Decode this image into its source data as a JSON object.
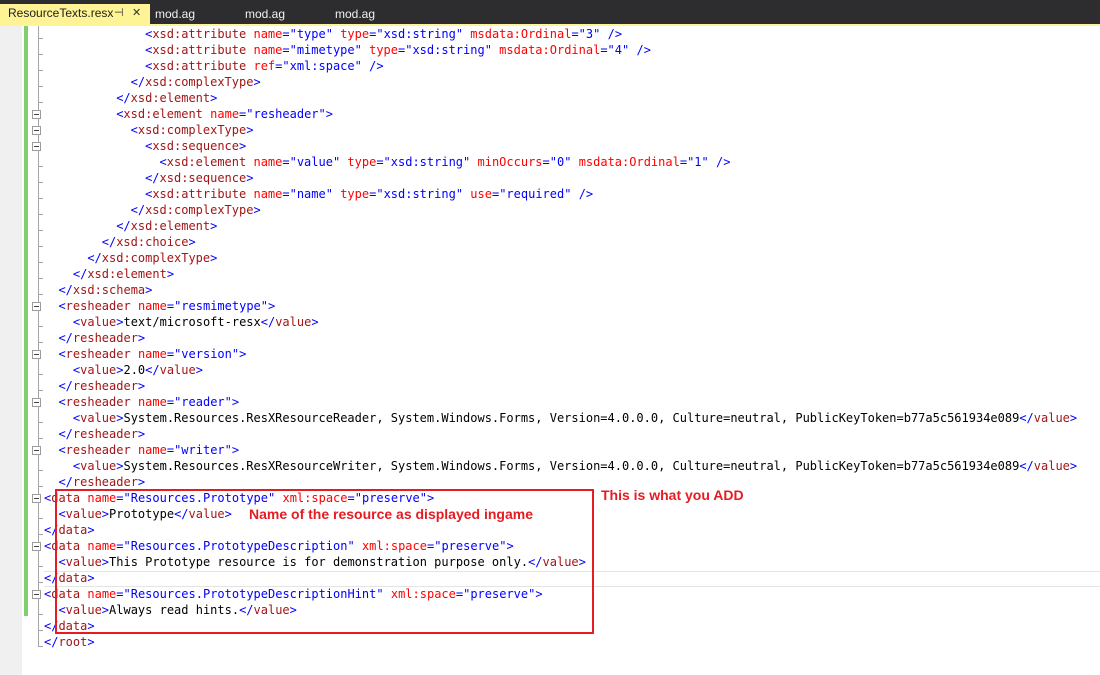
{
  "tabs": [
    {
      "label": "ResourceTexts.resx",
      "active": true,
      "pin": "⊣",
      "close": "✕"
    },
    {
      "label": "mod.ag",
      "active": false
    },
    {
      "label": "mod.ag",
      "active": false
    },
    {
      "label": "mod.ag",
      "active": false
    }
  ],
  "annotations": {
    "add_label": "This is what you ADD",
    "name_label": "Name of the resource as displayed ingame"
  },
  "code_lines": [
    [
      [
        "d",
        "<"
      ],
      [
        "e",
        "xsd:attribute"
      ],
      [
        "t",
        " "
      ],
      [
        "a",
        "name"
      ],
      [
        "d",
        "=\""
      ],
      [
        "v",
        "type"
      ],
      [
        "d",
        "\""
      ],
      [
        "t",
        " "
      ],
      [
        "a",
        "type"
      ],
      [
        "d",
        "=\""
      ],
      [
        "v",
        "xsd:string"
      ],
      [
        "d",
        "\""
      ],
      [
        "t",
        " "
      ],
      [
        "a",
        "msdata:Ordinal"
      ],
      [
        "d",
        "=\""
      ],
      [
        "v",
        "3"
      ],
      [
        "d",
        "\""
      ],
      [
        "t",
        " "
      ],
      [
        "d",
        "/>"
      ]
    ],
    [
      [
        "d",
        "<"
      ],
      [
        "e",
        "xsd:attribute"
      ],
      [
        "t",
        " "
      ],
      [
        "a",
        "name"
      ],
      [
        "d",
        "=\""
      ],
      [
        "v",
        "mimetype"
      ],
      [
        "d",
        "\""
      ],
      [
        "t",
        " "
      ],
      [
        "a",
        "type"
      ],
      [
        "d",
        "=\""
      ],
      [
        "v",
        "xsd:string"
      ],
      [
        "d",
        "\""
      ],
      [
        "t",
        " "
      ],
      [
        "a",
        "msdata:Ordinal"
      ],
      [
        "d",
        "=\""
      ],
      [
        "v",
        "4"
      ],
      [
        "d",
        "\""
      ],
      [
        "t",
        " "
      ],
      [
        "d",
        "/>"
      ]
    ],
    [
      [
        "d",
        "<"
      ],
      [
        "e",
        "xsd:attribute"
      ],
      [
        "t",
        " "
      ],
      [
        "a",
        "ref"
      ],
      [
        "d",
        "=\""
      ],
      [
        "v",
        "xml:space"
      ],
      [
        "d",
        "\""
      ],
      [
        "t",
        " "
      ],
      [
        "d",
        "/>"
      ]
    ],
    [
      [
        "d",
        "</"
      ],
      [
        "e",
        "xsd:complexType"
      ],
      [
        "d",
        ">"
      ]
    ],
    [
      [
        "d",
        "</"
      ],
      [
        "e",
        "xsd:element"
      ],
      [
        "d",
        ">"
      ]
    ],
    [
      [
        "d",
        "<"
      ],
      [
        "e",
        "xsd:element"
      ],
      [
        "t",
        " "
      ],
      [
        "a",
        "name"
      ],
      [
        "d",
        "=\""
      ],
      [
        "v",
        "resheader"
      ],
      [
        "d",
        "\""
      ],
      [
        "d",
        ">"
      ]
    ],
    [
      [
        "d",
        "<"
      ],
      [
        "e",
        "xsd:complexType"
      ],
      [
        "d",
        ">"
      ]
    ],
    [
      [
        "d",
        "<"
      ],
      [
        "e",
        "xsd:sequence"
      ],
      [
        "d",
        ">"
      ]
    ],
    [
      [
        "d",
        "<"
      ],
      [
        "e",
        "xsd:element"
      ],
      [
        "t",
        " "
      ],
      [
        "a",
        "name"
      ],
      [
        "d",
        "=\""
      ],
      [
        "v",
        "value"
      ],
      [
        "d",
        "\""
      ],
      [
        "t",
        " "
      ],
      [
        "a",
        "type"
      ],
      [
        "d",
        "=\""
      ],
      [
        "v",
        "xsd:string"
      ],
      [
        "d",
        "\""
      ],
      [
        "t",
        " "
      ],
      [
        "a",
        "minOccurs"
      ],
      [
        "d",
        "=\""
      ],
      [
        "v",
        "0"
      ],
      [
        "d",
        "\""
      ],
      [
        "t",
        " "
      ],
      [
        "a",
        "msdata:Ordinal"
      ],
      [
        "d",
        "=\""
      ],
      [
        "v",
        "1"
      ],
      [
        "d",
        "\""
      ],
      [
        "t",
        " "
      ],
      [
        "d",
        "/>"
      ]
    ],
    [
      [
        "d",
        "</"
      ],
      [
        "e",
        "xsd:sequence"
      ],
      [
        "d",
        ">"
      ]
    ],
    [
      [
        "d",
        "<"
      ],
      [
        "e",
        "xsd:attribute"
      ],
      [
        "t",
        " "
      ],
      [
        "a",
        "name"
      ],
      [
        "d",
        "=\""
      ],
      [
        "v",
        "name"
      ],
      [
        "d",
        "\""
      ],
      [
        "t",
        " "
      ],
      [
        "a",
        "type"
      ],
      [
        "d",
        "=\""
      ],
      [
        "v",
        "xsd:string"
      ],
      [
        "d",
        "\""
      ],
      [
        "t",
        " "
      ],
      [
        "a",
        "use"
      ],
      [
        "d",
        "=\""
      ],
      [
        "v",
        "required"
      ],
      [
        "d",
        "\""
      ],
      [
        "t",
        " "
      ],
      [
        "d",
        "/>"
      ]
    ],
    [
      [
        "d",
        "</"
      ],
      [
        "e",
        "xsd:complexType"
      ],
      [
        "d",
        ">"
      ]
    ],
    [
      [
        "d",
        "</"
      ],
      [
        "e",
        "xsd:element"
      ],
      [
        "d",
        ">"
      ]
    ],
    [
      [
        "d",
        "</"
      ],
      [
        "e",
        "xsd:choice"
      ],
      [
        "d",
        ">"
      ]
    ],
    [
      [
        "d",
        "</"
      ],
      [
        "e",
        "xsd:complexType"
      ],
      [
        "d",
        ">"
      ]
    ],
    [
      [
        "d",
        "</"
      ],
      [
        "e",
        "xsd:element"
      ],
      [
        "d",
        ">"
      ]
    ],
    [
      [
        "d",
        "</"
      ],
      [
        "e",
        "xsd:schema"
      ],
      [
        "d",
        ">"
      ]
    ],
    [
      [
        "d",
        "<"
      ],
      [
        "e",
        "resheader"
      ],
      [
        "t",
        " "
      ],
      [
        "a",
        "name"
      ],
      [
        "d",
        "=\""
      ],
      [
        "v",
        "resmimetype"
      ],
      [
        "d",
        "\""
      ],
      [
        "d",
        ">"
      ]
    ],
    [
      [
        "d",
        "<"
      ],
      [
        "e",
        "value"
      ],
      [
        "d",
        ">"
      ],
      [
        "t",
        "text/microsoft-resx"
      ],
      [
        "d",
        "</"
      ],
      [
        "e",
        "value"
      ],
      [
        "d",
        ">"
      ]
    ],
    [
      [
        "d",
        "</"
      ],
      [
        "e",
        "resheader"
      ],
      [
        "d",
        ">"
      ]
    ],
    [
      [
        "d",
        "<"
      ],
      [
        "e",
        "resheader"
      ],
      [
        "t",
        " "
      ],
      [
        "a",
        "name"
      ],
      [
        "d",
        "=\""
      ],
      [
        "v",
        "version"
      ],
      [
        "d",
        "\""
      ],
      [
        "d",
        ">"
      ]
    ],
    [
      [
        "d",
        "<"
      ],
      [
        "e",
        "value"
      ],
      [
        "d",
        ">"
      ],
      [
        "t",
        "2.0"
      ],
      [
        "d",
        "</"
      ],
      [
        "e",
        "value"
      ],
      [
        "d",
        ">"
      ]
    ],
    [
      [
        "d",
        "</"
      ],
      [
        "e",
        "resheader"
      ],
      [
        "d",
        ">"
      ]
    ],
    [
      [
        "d",
        "<"
      ],
      [
        "e",
        "resheader"
      ],
      [
        "t",
        " "
      ],
      [
        "a",
        "name"
      ],
      [
        "d",
        "=\""
      ],
      [
        "v",
        "reader"
      ],
      [
        "d",
        "\""
      ],
      [
        "d",
        ">"
      ]
    ],
    [
      [
        "d",
        "<"
      ],
      [
        "e",
        "value"
      ],
      [
        "d",
        ">"
      ],
      [
        "t",
        "System.Resources.ResXResourceReader, System.Windows.Forms, Version=4.0.0.0, Culture=neutral, PublicKeyToken=b77a5c561934e089"
      ],
      [
        "d",
        "</"
      ],
      [
        "e",
        "value"
      ],
      [
        "d",
        ">"
      ]
    ],
    [
      [
        "d",
        "</"
      ],
      [
        "e",
        "resheader"
      ],
      [
        "d",
        ">"
      ]
    ],
    [
      [
        "d",
        "<"
      ],
      [
        "e",
        "resheader"
      ],
      [
        "t",
        " "
      ],
      [
        "a",
        "name"
      ],
      [
        "d",
        "=\""
      ],
      [
        "v",
        "writer"
      ],
      [
        "d",
        "\""
      ],
      [
        "d",
        ">"
      ]
    ],
    [
      [
        "d",
        "<"
      ],
      [
        "e",
        "value"
      ],
      [
        "d",
        ">"
      ],
      [
        "t",
        "System.Resources.ResXResourceWriter, System.Windows.Forms, Version=4.0.0.0, Culture=neutral, PublicKeyToken=b77a5c561934e089"
      ],
      [
        "d",
        "</"
      ],
      [
        "e",
        "value"
      ],
      [
        "d",
        ">"
      ]
    ],
    [
      [
        "d",
        "</"
      ],
      [
        "e",
        "resheader"
      ],
      [
        "d",
        ">"
      ]
    ],
    [
      [
        "d",
        "<"
      ],
      [
        "e",
        "data"
      ],
      [
        "t",
        " "
      ],
      [
        "a",
        "name"
      ],
      [
        "d",
        "=\""
      ],
      [
        "v",
        "Resources.Prototype"
      ],
      [
        "d",
        "\""
      ],
      [
        "t",
        " "
      ],
      [
        "a",
        "xml:space"
      ],
      [
        "d",
        "=\""
      ],
      [
        "v",
        "preserve"
      ],
      [
        "d",
        "\""
      ],
      [
        "d",
        ">"
      ]
    ],
    [
      [
        "d",
        "<"
      ],
      [
        "e",
        "value"
      ],
      [
        "d",
        ">"
      ],
      [
        "t",
        "Prototype"
      ],
      [
        "d",
        "</"
      ],
      [
        "e",
        "value"
      ],
      [
        "d",
        ">"
      ]
    ],
    [
      [
        "d",
        "</"
      ],
      [
        "e",
        "data"
      ],
      [
        "d",
        ">"
      ]
    ],
    [
      [
        "d",
        "<"
      ],
      [
        "e",
        "data"
      ],
      [
        "t",
        " "
      ],
      [
        "a",
        "name"
      ],
      [
        "d",
        "=\""
      ],
      [
        "v",
        "Resources.PrototypeDescription"
      ],
      [
        "d",
        "\""
      ],
      [
        "t",
        " "
      ],
      [
        "a",
        "xml:space"
      ],
      [
        "d",
        "=\""
      ],
      [
        "v",
        "preserve"
      ],
      [
        "d",
        "\""
      ],
      [
        "d",
        ">"
      ]
    ],
    [
      [
        "d",
        "<"
      ],
      [
        "e",
        "value"
      ],
      [
        "d",
        ">"
      ],
      [
        "t",
        "This Prototype resource is for demonstration purpose only."
      ],
      [
        "d",
        "</"
      ],
      [
        "e",
        "value"
      ],
      [
        "d",
        ">"
      ]
    ],
    [
      [
        "d",
        "</"
      ],
      [
        "e",
        "data"
      ],
      [
        "d",
        ">"
      ]
    ],
    [
      [
        "d",
        "<"
      ],
      [
        "e",
        "data"
      ],
      [
        "t",
        " "
      ],
      [
        "a",
        "name"
      ],
      [
        "d",
        "=\""
      ],
      [
        "v",
        "Resources.PrototypeDescriptionHint"
      ],
      [
        "d",
        "\""
      ],
      [
        "t",
        " "
      ],
      [
        "a",
        "xml:space"
      ],
      [
        "d",
        "=\""
      ],
      [
        "v",
        "preserve"
      ],
      [
        "d",
        "\""
      ],
      [
        "d",
        ">"
      ]
    ],
    [
      [
        "d",
        "<"
      ],
      [
        "e",
        "value"
      ],
      [
        "d",
        ">"
      ],
      [
        "t",
        "Always read hints."
      ],
      [
        "d",
        "</"
      ],
      [
        "e",
        "value"
      ],
      [
        "d",
        ">"
      ]
    ],
    [
      [
        "d",
        "</"
      ],
      [
        "e",
        "data"
      ],
      [
        "d",
        ">"
      ]
    ],
    [
      [
        "d",
        "</"
      ],
      [
        "e",
        "root"
      ],
      [
        "d",
        ">"
      ]
    ]
  ]
}
